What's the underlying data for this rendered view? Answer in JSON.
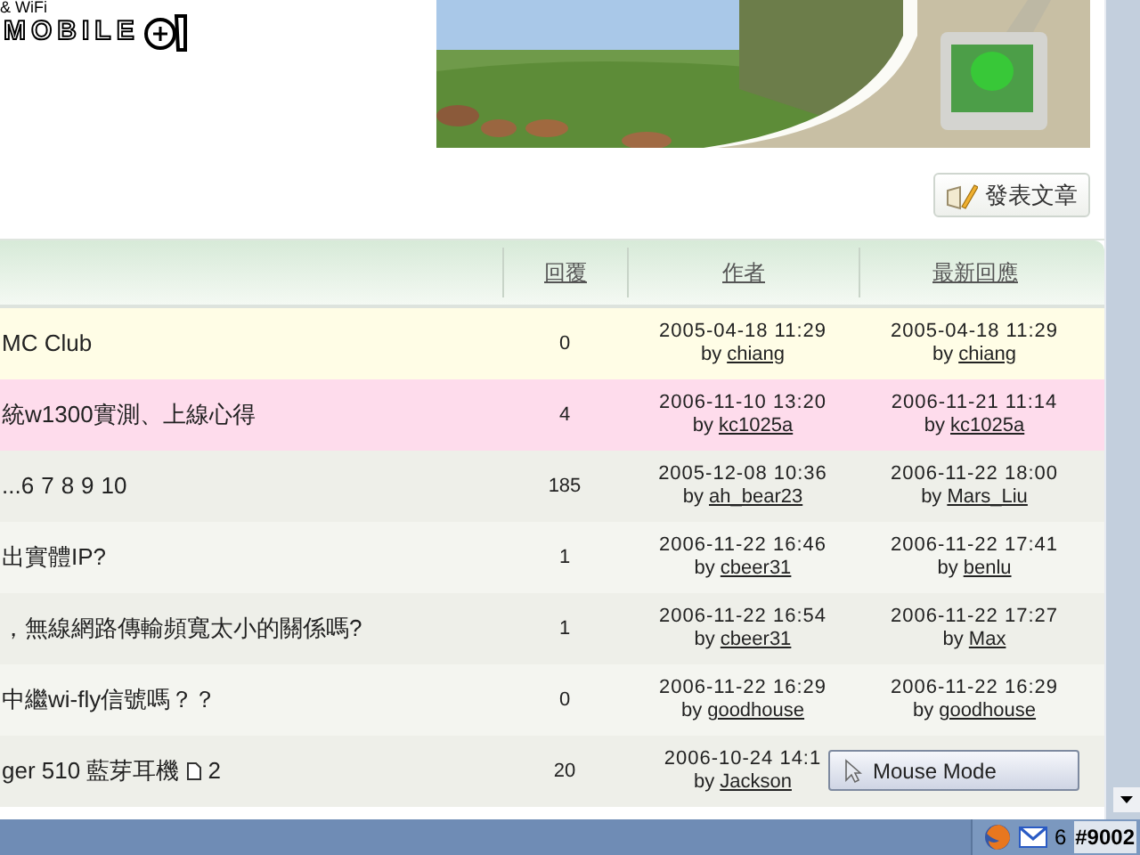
{
  "logo": {
    "tagline": "& WiFi",
    "wordmark": "MOBILE"
  },
  "post_button": {
    "label": "發表文章"
  },
  "table": {
    "columns": [
      "回覆",
      "作者",
      "最新回應"
    ],
    "rows": [
      {
        "kind": "sticky",
        "title": "MC Club",
        "pages": [],
        "replies": "0",
        "author_time": "2005-04-18 11:29",
        "author_by": "by",
        "author": "chiang",
        "last_time": "2005-04-18 11:29",
        "last_by_label": "by",
        "last_by": "chiang"
      },
      {
        "kind": "highlight",
        "title": "統w1300實測、上線心得",
        "pages": [],
        "replies": "4",
        "author_time": "2006-11-10 13:20",
        "author_by": "by",
        "author": "kc1025a",
        "last_time": "2006-11-21 11:14",
        "last_by_label": "by",
        "last_by": "kc1025a"
      },
      {
        "kind": "normal",
        "pages": [
          "...6",
          "7",
          "8",
          "9",
          "10"
        ],
        "replies": "185",
        "author_time": "2005-12-08 10:36",
        "author_by": "by",
        "author": "ah_bear23",
        "last_time": "2006-11-22 18:00",
        "last_by_label": "by",
        "last_by": "Mars_Liu"
      },
      {
        "kind": "normal",
        "title": "出實體IP?",
        "pages": [],
        "replies": "1",
        "author_time": "2006-11-22 16:46",
        "author_by": "by",
        "author": "cbeer31",
        "last_time": "2006-11-22 17:41",
        "last_by_label": "by",
        "last_by": "benlu"
      },
      {
        "kind": "normal",
        "title": "，無線網路傳輸頻寬太小的關係嗎?",
        "pages": [],
        "replies": "1",
        "author_time": "2006-11-22 16:54",
        "author_by": "by",
        "author": "cbeer31",
        "last_time": "2006-11-22 17:27",
        "last_by_label": "by",
        "last_by": "Max"
      },
      {
        "kind": "normal",
        "title": "中繼wi-fly信號嗎？？",
        "pages": [],
        "replies": "0",
        "author_time": "2006-11-22 16:29",
        "author_by": "by",
        "author": "goodhouse",
        "last_time": "2006-11-22 16:29",
        "last_by_label": "by",
        "last_by": "goodhouse"
      },
      {
        "kind": "normal",
        "title": "ger 510 藍芽耳機",
        "page_icon": true,
        "pages": [
          "2"
        ],
        "replies": "20",
        "author_time": "2006-10-24 14:1",
        "author_by": "by",
        "author": "Jackson"
      }
    ]
  },
  "tooltip": {
    "label": "Mouse Mode"
  },
  "taskbar": {
    "mail_count": "6",
    "tray_text": "#9002"
  }
}
